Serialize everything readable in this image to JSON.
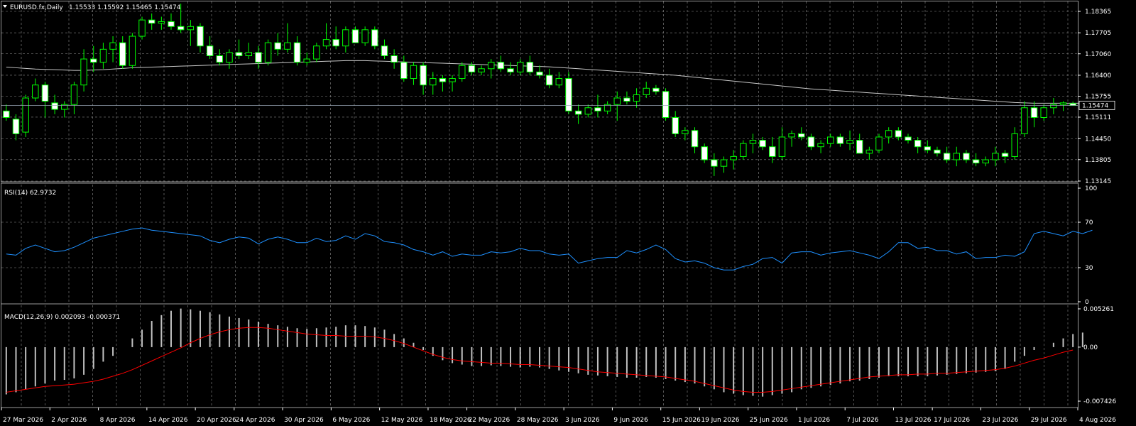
{
  "header": {
    "symbol": "EURUSD.fx,Daily",
    "ohlc": "1.15533 1.15592 1.15465 1.15474"
  },
  "rsi": {
    "label": "RSI(14) 62.9732",
    "scale_labels": [
      "100",
      "70",
      "30",
      "0"
    ],
    "scale_values": [
      100,
      70,
      30,
      0
    ]
  },
  "macd": {
    "label": "MACD(12,26,9) 0.002093 -0.000371",
    "scale_labels": [
      "0.005261",
      "0.00",
      "-0.007426"
    ],
    "scale_values": [
      0.005261,
      0,
      -0.007426
    ]
  },
  "colors": {
    "background": "#000000",
    "bull_body": "#000000",
    "bear_body": "#ffffff",
    "wick": "#00ff00",
    "grid": "#8c8c8c",
    "ma_line": "#c8c8c8",
    "rsi_line": "#1e90ff",
    "macd_hist": "#c0c0c0",
    "macd_signal": "#ff0000",
    "price_tag_bg": "#000000",
    "price_tag_text": "#ffffff"
  },
  "price_axis": {
    "labels": [
      "1.18365",
      "1.17705",
      "1.17060",
      "1.16400",
      "1.15755",
      "1.15111",
      "1.14450",
      "1.13805",
      "1.13145"
    ],
    "values": [
      1.18365,
      1.17705,
      1.1706,
      1.164,
      1.15755,
      1.15111,
      1.1445,
      1.13805,
      1.13145
    ],
    "current_label": "1.15474",
    "current_value": 1.15474
  },
  "time_axis": {
    "labels": [
      "27 Mar 2026",
      "2 Apr 2026",
      "8 Apr 2026",
      "14 Apr 2026",
      "20 Apr 2026",
      "24 Apr 2026",
      "30 Apr 2026",
      "6 May 2026",
      "12 May 2026",
      "18 May 2026",
      "22 May 2026",
      "28 May 2026",
      "3 Jun 2026",
      "9 Jun 2026",
      "15 Jun 2026",
      "19 Jun 2026",
      "25 Jun 2026",
      "1 Jul 2026",
      "7 Jul 2026",
      "13 Jul 2026",
      "17 Jul 2026",
      "23 Jul 2026",
      "29 Jul 2026",
      "4 Aug 2026"
    ],
    "bar_index": [
      0,
      5,
      10,
      15,
      20,
      24,
      29,
      34,
      39,
      44,
      48,
      53,
      58,
      63,
      68,
      72,
      77,
      82,
      87,
      92,
      96,
      101,
      106,
      111
    ]
  },
  "chart_data": [
    {
      "type": "candlestick",
      "title": "EURUSD.fx,Daily",
      "ylim": [
        1.13145,
        1.18365
      ],
      "ohlc": [
        [
          1.153,
          1.155,
          1.15,
          1.151
        ],
        [
          1.1505,
          1.152,
          1.144,
          1.146
        ],
        [
          1.1465,
          1.158,
          1.145,
          1.157
        ],
        [
          1.157,
          1.163,
          1.156,
          1.161
        ],
        [
          1.161,
          1.162,
          1.151,
          1.156
        ],
        [
          1.1555,
          1.158,
          1.152,
          1.1535
        ],
        [
          1.1535,
          1.156,
          1.151,
          1.155
        ],
        [
          1.155,
          1.162,
          1.152,
          1.161
        ],
        [
          1.161,
          1.172,
          1.159,
          1.169
        ],
        [
          1.169,
          1.173,
          1.165,
          1.168
        ],
        [
          1.168,
          1.174,
          1.166,
          1.172
        ],
        [
          1.172,
          1.176,
          1.168,
          1.174
        ],
        [
          1.174,
          1.176,
          1.166,
          1.167
        ],
        [
          1.167,
          1.177,
          1.166,
          1.176
        ],
        [
          1.176,
          1.182,
          1.175,
          1.181
        ],
        [
          1.181,
          1.183,
          1.178,
          1.18
        ],
        [
          1.18,
          1.182,
          1.178,
          1.1805
        ],
        [
          1.1805,
          1.183,
          1.178,
          1.179
        ],
        [
          1.179,
          1.186,
          1.177,
          1.178
        ],
        [
          1.178,
          1.181,
          1.173,
          1.179
        ],
        [
          1.179,
          1.18,
          1.171,
          1.173
        ],
        [
          1.173,
          1.176,
          1.169,
          1.17
        ],
        [
          1.17,
          1.172,
          1.167,
          1.168
        ],
        [
          1.168,
          1.172,
          1.166,
          1.171
        ],
        [
          1.171,
          1.175,
          1.169,
          1.17
        ],
        [
          1.17,
          1.174,
          1.169,
          1.171
        ],
        [
          1.171,
          1.173,
          1.166,
          1.168
        ],
        [
          1.168,
          1.175,
          1.167,
          1.174
        ],
        [
          1.174,
          1.177,
          1.17,
          1.172
        ],
        [
          1.172,
          1.18,
          1.171,
          1.174
        ],
        [
          1.174,
          1.176,
          1.167,
          1.168
        ],
        [
          1.168,
          1.171,
          1.167,
          1.169
        ],
        [
          1.169,
          1.174,
          1.168,
          1.173
        ],
        [
          1.173,
          1.18,
          1.172,
          1.175
        ],
        [
          1.175,
          1.179,
          1.172,
          1.173
        ],
        [
          1.173,
          1.179,
          1.171,
          1.178
        ],
        [
          1.178,
          1.179,
          1.174,
          1.174
        ],
        [
          1.174,
          1.179,
          1.173,
          1.178
        ],
        [
          1.178,
          1.179,
          1.172,
          1.173
        ],
        [
          1.173,
          1.175,
          1.169,
          1.17
        ],
        [
          1.17,
          1.172,
          1.166,
          1.168
        ],
        [
          1.168,
          1.17,
          1.162,
          1.163
        ],
        [
          1.163,
          1.168,
          1.161,
          1.167
        ],
        [
          1.167,
          1.168,
          1.158,
          1.161
        ],
        [
          1.161,
          1.165,
          1.158,
          1.163
        ],
        [
          1.163,
          1.164,
          1.159,
          1.162
        ],
        [
          1.162,
          1.164,
          1.159,
          1.163
        ],
        [
          1.163,
          1.168,
          1.162,
          1.167
        ],
        [
          1.167,
          1.168,
          1.164,
          1.165
        ],
        [
          1.165,
          1.167,
          1.164,
          1.166
        ],
        [
          1.166,
          1.169,
          1.163,
          1.168
        ],
        [
          1.168,
          1.17,
          1.165,
          1.166
        ],
        [
          1.166,
          1.168,
          1.164,
          1.165
        ],
        [
          1.165,
          1.169,
          1.164,
          1.168
        ],
        [
          1.168,
          1.17,
          1.164,
          1.165
        ],
        [
          1.165,
          1.167,
          1.163,
          1.164
        ],
        [
          1.164,
          1.166,
          1.16,
          1.161
        ],
        [
          1.161,
          1.165,
          1.16,
          1.163
        ],
        [
          1.163,
          1.165,
          1.152,
          1.153
        ],
        [
          1.153,
          1.155,
          1.149,
          1.152
        ],
        [
          1.152,
          1.155,
          1.151,
          1.154
        ],
        [
          1.154,
          1.158,
          1.151,
          1.153
        ],
        [
          1.153,
          1.156,
          1.152,
          1.155
        ],
        [
          1.155,
          1.159,
          1.15,
          1.157
        ],
        [
          1.157,
          1.159,
          1.155,
          1.156
        ],
        [
          1.156,
          1.16,
          1.154,
          1.158
        ],
        [
          1.158,
          1.162,
          1.157,
          1.16
        ],
        [
          1.16,
          1.161,
          1.158,
          1.159
        ],
        [
          1.159,
          1.16,
          1.15,
          1.151
        ],
        [
          1.151,
          1.153,
          1.145,
          1.146
        ],
        [
          1.146,
          1.148,
          1.144,
          1.147
        ],
        [
          1.147,
          1.148,
          1.14,
          1.142
        ],
        [
          1.142,
          1.143,
          1.137,
          1.138
        ],
        [
          1.138,
          1.14,
          1.133,
          1.136
        ],
        [
          1.136,
          1.139,
          1.134,
          1.138
        ],
        [
          1.138,
          1.141,
          1.135,
          1.139
        ],
        [
          1.139,
          1.144,
          1.138,
          1.143
        ],
        [
          1.143,
          1.146,
          1.14,
          1.144
        ],
        [
          1.144,
          1.145,
          1.141,
          1.142
        ],
        [
          1.142,
          1.145,
          1.137,
          1.139
        ],
        [
          1.139,
          1.148,
          1.138,
          1.145
        ],
        [
          1.145,
          1.147,
          1.142,
          1.146
        ],
        [
          1.146,
          1.148,
          1.144,
          1.145
        ],
        [
          1.145,
          1.146,
          1.141,
          1.142
        ],
        [
          1.142,
          1.144,
          1.14,
          1.143
        ],
        [
          1.143,
          1.146,
          1.142,
          1.145
        ],
        [
          1.145,
          1.146,
          1.142,
          1.143
        ],
        [
          1.143,
          1.147,
          1.141,
          1.144
        ],
        [
          1.144,
          1.146,
          1.141,
          1.14
        ],
        [
          1.14,
          1.142,
          1.138,
          1.141
        ],
        [
          1.141,
          1.146,
          1.14,
          1.145
        ],
        [
          1.145,
          1.148,
          1.143,
          1.147
        ],
        [
          1.147,
          1.148,
          1.144,
          1.145
        ],
        [
          1.145,
          1.146,
          1.143,
          1.144
        ],
        [
          1.144,
          1.145,
          1.14,
          1.142
        ],
        [
          1.142,
          1.144,
          1.14,
          1.141
        ],
        [
          1.141,
          1.142,
          1.139,
          1.14
        ],
        [
          1.14,
          1.142,
          1.137,
          1.138
        ],
        [
          1.138,
          1.142,
          1.136,
          1.14
        ],
        [
          1.14,
          1.141,
          1.137,
          1.138
        ],
        [
          1.138,
          1.14,
          1.136,
          1.137
        ],
        [
          1.137,
          1.139,
          1.136,
          1.138
        ],
        [
          1.138,
          1.142,
          1.136,
          1.14
        ],
        [
          1.14,
          1.141,
          1.137,
          1.139
        ],
        [
          1.139,
          1.148,
          1.138,
          1.146
        ],
        [
          1.146,
          1.156,
          1.145,
          1.154
        ],
        [
          1.154,
          1.156,
          1.148,
          1.151
        ],
        [
          1.151,
          1.155,
          1.15,
          1.154
        ],
        [
          1.154,
          1.157,
          1.152,
          1.155
        ],
        [
          1.155,
          1.156,
          1.153,
          1.1555
        ],
        [
          1.1553,
          1.1559,
          1.1546,
          1.1547
        ]
      ],
      "ma": [
        1.1665,
        1.1663,
        1.1661,
        1.1659,
        1.1658,
        1.1657,
        1.1656,
        1.1655,
        1.1655,
        1.1656,
        1.1657,
        1.1659,
        1.1661,
        1.1663,
        1.1664,
        1.1665,
        1.1666,
        1.1667,
        1.1668,
        1.1669,
        1.167,
        1.1671,
        1.1672,
        1.1673,
        1.1674,
        1.1675,
        1.1676,
        1.1677,
        1.1678,
        1.1679,
        1.168,
        1.1681,
        1.1682,
        1.1683,
        1.1684,
        1.1685,
        1.1685,
        1.1685,
        1.1684,
        1.1683,
        1.1682,
        1.1681,
        1.168,
        1.1679,
        1.1678,
        1.1677,
        1.1676,
        1.1675,
        1.1674,
        1.1673,
        1.1672,
        1.1671,
        1.167,
        1.1669,
        1.1668,
        1.1667,
        1.1666,
        1.1664,
        1.1662,
        1.166,
        1.1658,
        1.1656,
        1.1654,
        1.1652,
        1.165,
        1.1648,
        1.1646,
        1.1644,
        1.1642,
        1.164,
        1.1637,
        1.1634,
        1.1631,
        1.1628,
        1.1625,
        1.1622,
        1.1619,
        1.1616,
        1.1613,
        1.161,
        1.1607,
        1.1604,
        1.1601,
        1.1598,
        1.1596,
        1.1594,
        1.1592,
        1.159,
        1.1588,
        1.1586,
        1.1584,
        1.1582,
        1.158,
        1.1578,
        1.1576,
        1.1574,
        1.1572,
        1.157,
        1.1568,
        1.1566,
        1.1564,
        1.1562,
        1.156,
        1.1558,
        1.1556,
        1.1555,
        1.1554,
        1.1554,
        1.1554,
        1.1554,
        1.1554,
        1.1554
      ]
    },
    {
      "type": "line",
      "title": "RSI(14) 62.9732",
      "ylim": [
        0,
        100
      ],
      "values": [
        42,
        41,
        47,
        50,
        47,
        44,
        45,
        48,
        52,
        56,
        58,
        60,
        62,
        64,
        65,
        63,
        62,
        61,
        60,
        59,
        58,
        54,
        52,
        55,
        57,
        56,
        51,
        55,
        57,
        55,
        52,
        52,
        56,
        53,
        54,
        58,
        55,
        60,
        58,
        53,
        52,
        50,
        46,
        44,
        41,
        44,
        40,
        42,
        41,
        41,
        44,
        43,
        44,
        47,
        45,
        45,
        42,
        41,
        42,
        34,
        36,
        38,
        39,
        39,
        45,
        43,
        46,
        50,
        46,
        38,
        35,
        36,
        34,
        30,
        28,
        28,
        31,
        33,
        38,
        39,
        34,
        43,
        44,
        44,
        41,
        43,
        44,
        45,
        43,
        41,
        38,
        44,
        52,
        52,
        47,
        48,
        45,
        45,
        42,
        44,
        38,
        39,
        39,
        41,
        40,
        44,
        60,
        62,
        60,
        58,
        62,
        60,
        62.97
      ]
    },
    {
      "type": "bar",
      "title": "MACD(12,26,9) 0.002093 -0.000371",
      "ylim": [
        -0.007426,
        0.005261
      ],
      "values": [
        -0.0065,
        -0.0062,
        -0.0058,
        -0.0054,
        -0.005,
        -0.0046,
        -0.0045,
        -0.0043,
        -0.0038,
        -0.003,
        -0.002,
        -0.0012,
        0.0,
        0.0012,
        0.0024,
        0.0036,
        0.0044,
        0.005,
        0.0053,
        0.0052,
        0.005,
        0.0048,
        0.0045,
        0.0042,
        0.004,
        0.0038,
        0.0035,
        0.0032,
        0.003,
        0.0028,
        0.0026,
        0.0025,
        0.0026,
        0.0027,
        0.0028,
        0.003,
        0.003,
        0.0029,
        0.0027,
        0.0024,
        0.0018,
        0.0012,
        0.0006,
        -0.0004,
        -0.0012,
        -0.0018,
        -0.0022,
        -0.0024,
        -0.0026,
        -0.0026,
        -0.0025,
        -0.0026,
        -0.0027,
        -0.0028,
        -0.0027,
        -0.0028,
        -0.003,
        -0.0032,
        -0.0034,
        -0.0036,
        -0.0038,
        -0.0039,
        -0.004,
        -0.0041,
        -0.0042,
        -0.0042,
        -0.0041,
        -0.0042,
        -0.0044,
        -0.0046,
        -0.0048,
        -0.005,
        -0.0054,
        -0.0058,
        -0.0062,
        -0.0064,
        -0.0066,
        -0.0067,
        -0.0068,
        -0.0066,
        -0.0064,
        -0.0062,
        -0.0058,
        -0.0056,
        -0.0054,
        -0.0052,
        -0.005,
        -0.0047,
        -0.0046,
        -0.0044,
        -0.0042,
        -0.004,
        -0.004,
        -0.004,
        -0.004,
        -0.004,
        -0.0039,
        -0.0038,
        -0.0037,
        -0.0036,
        -0.0035,
        -0.0034,
        -0.0033,
        -0.003,
        -0.002,
        -0.0012,
        -0.0004,
        0.0,
        0.0006,
        0.0012,
        0.0018,
        0.002
      ],
      "signal": [
        -0.0062,
        -0.006,
        -0.0058,
        -0.0056,
        -0.0054,
        -0.0053,
        -0.0052,
        -0.0051,
        -0.0049,
        -0.0047,
        -0.0044,
        -0.004,
        -0.0036,
        -0.0031,
        -0.0025,
        -0.0019,
        -0.0013,
        -0.0007,
        -0.0001,
        0.0006,
        0.0012,
        0.0017,
        0.0021,
        0.0024,
        0.0026,
        0.0027,
        0.0027,
        0.0026,
        0.0024,
        0.0022,
        0.002,
        0.0018,
        0.0017,
        0.0016,
        0.0016,
        0.0015,
        0.0015,
        0.0015,
        0.0014,
        0.0012,
        0.0009,
        0.0005,
        0.0,
        -0.0005,
        -0.001,
        -0.0014,
        -0.0017,
        -0.0019,
        -0.002,
        -0.0021,
        -0.0022,
        -0.0022,
        -0.0023,
        -0.0024,
        -0.0024,
        -0.0025,
        -0.0026,
        -0.0027,
        -0.0028,
        -0.003,
        -0.0032,
        -0.0034,
        -0.0035,
        -0.0036,
        -0.0037,
        -0.0038,
        -0.0039,
        -0.004,
        -0.0041,
        -0.0043,
        -0.0045,
        -0.0047,
        -0.005,
        -0.0053,
        -0.0056,
        -0.0059,
        -0.0061,
        -0.0062,
        -0.0062,
        -0.0061,
        -0.0059,
        -0.0057,
        -0.0055,
        -0.0053,
        -0.0051,
        -0.0049,
        -0.0047,
        -0.0045,
        -0.0043,
        -0.0041,
        -0.004,
        -0.0039,
        -0.0038,
        -0.0038,
        -0.0037,
        -0.0037,
        -0.0036,
        -0.0036,
        -0.0035,
        -0.0034,
        -0.0033,
        -0.0032,
        -0.0031,
        -0.0029,
        -0.0026,
        -0.0022,
        -0.0018,
        -0.0015,
        -0.0011,
        -0.0007,
        -0.0004
      ]
    }
  ]
}
